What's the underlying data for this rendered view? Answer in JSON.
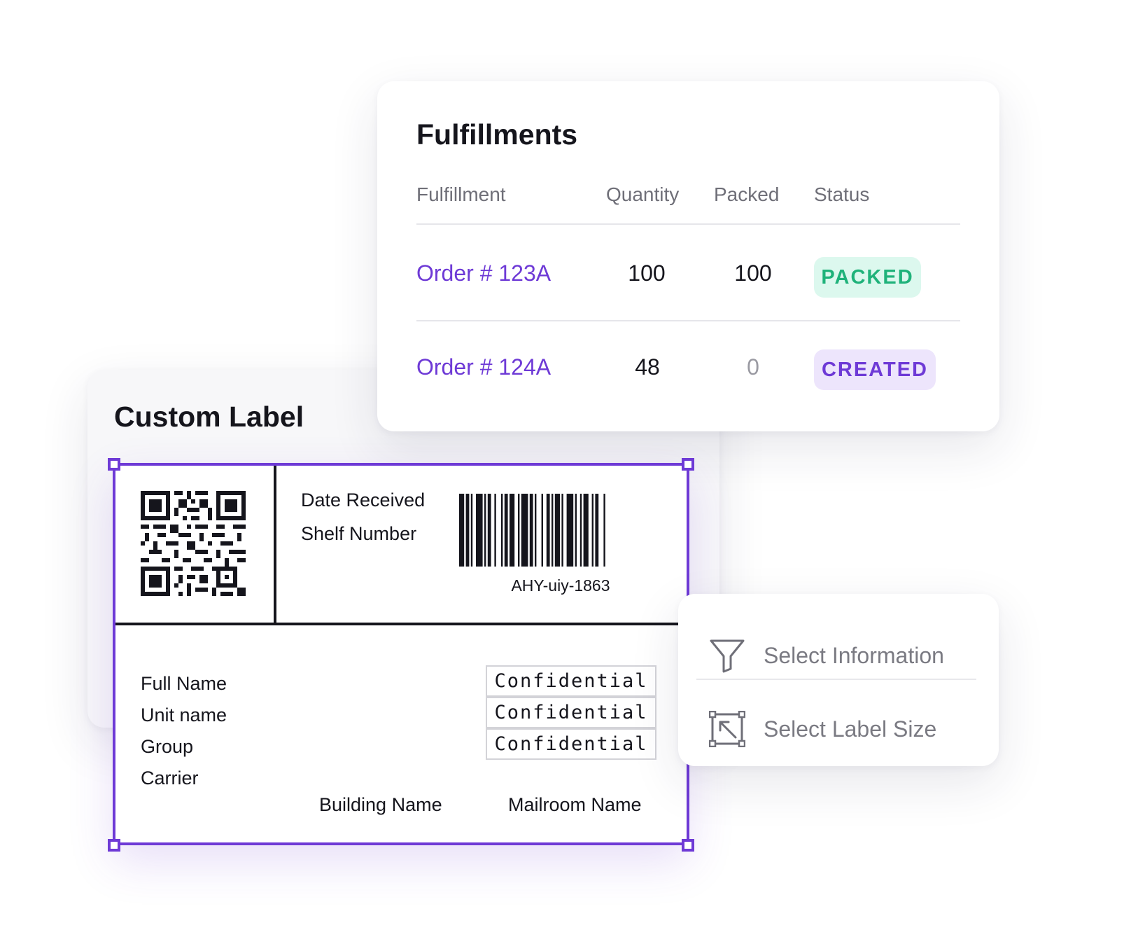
{
  "custom_label": {
    "title": "Custom Label",
    "label": {
      "date_received": "Date Received",
      "shelf_number": "Shelf Number",
      "barcode_text": "AHY-uiy-1863",
      "fields": [
        "Full Name",
        "Unit name",
        "Group",
        "Carrier"
      ],
      "confidential": [
        "Confidential",
        "Confidential",
        "Confidential"
      ],
      "building_name": "Building Name",
      "mailroom_name": "Mailroom Name"
    }
  },
  "fulfillments": {
    "title": "Fulfillments",
    "columns": [
      "Fulfillment",
      "Quantity",
      "Packed",
      "Status"
    ],
    "rows": [
      {
        "order": "Order # 123A",
        "quantity": "100",
        "packed": "100",
        "status": "PACKED"
      },
      {
        "order": "Order # 124A",
        "quantity": "48",
        "packed": "0",
        "status": "CREATED"
      }
    ]
  },
  "options": {
    "items": [
      {
        "label": "Select Information",
        "icon": "funnel-icon"
      },
      {
        "label": "Select Label Size",
        "icon": "resize-icon"
      }
    ]
  },
  "colors": {
    "accent": "#6e3ad6",
    "packed_badge_bg": "#dcf8ee",
    "packed_badge_text": "#1fb27a",
    "created_badge_bg": "#ede5fc",
    "created_badge_text": "#6e3ad6",
    "text_dark": "#15151c",
    "text_muted": "#6f6f78"
  }
}
